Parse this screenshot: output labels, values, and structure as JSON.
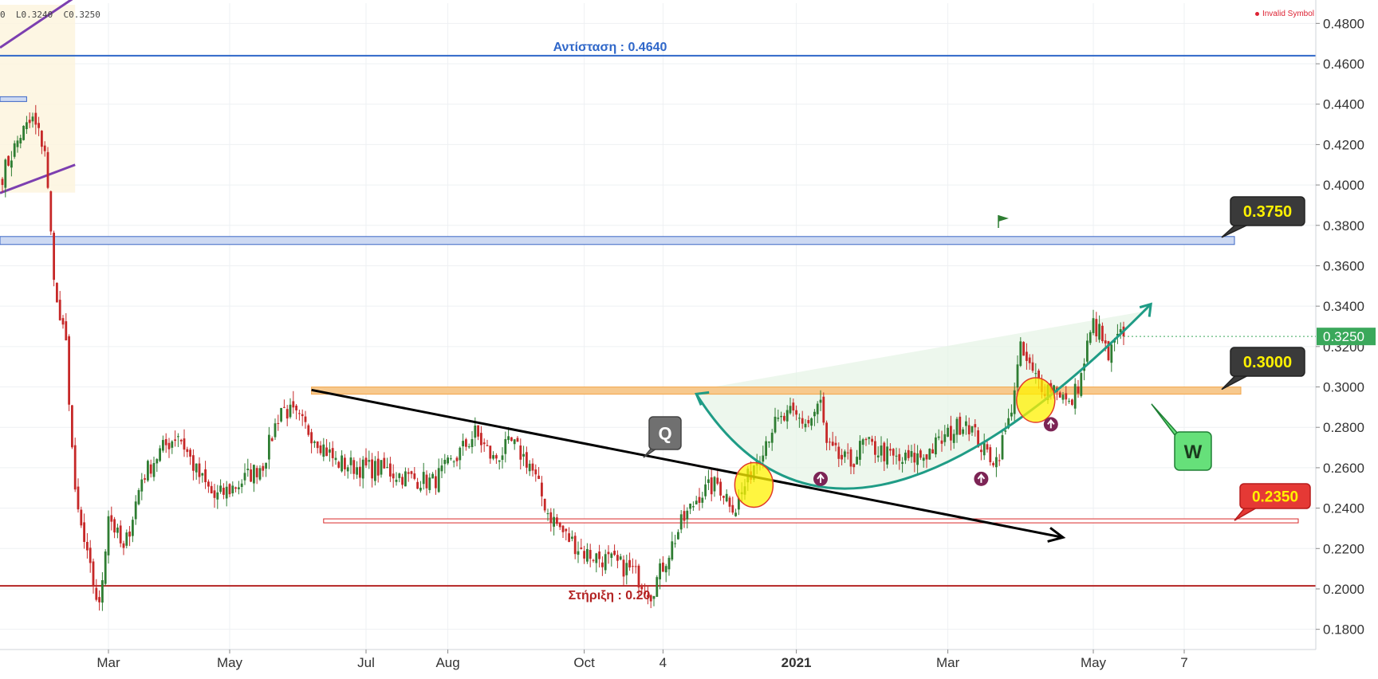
{
  "header": {
    "ohlc_text": "0  L0.3240  C0.3250",
    "invalid_symbol": "Invalid Symbol"
  },
  "colors": {
    "up_candle": "#2e7d32",
    "down_candle": "#c62828",
    "resistance_line": "#2f67c9",
    "support_line": "#b32323",
    "cup_arc": "#1f9c86",
    "trend_arrow": "#000000",
    "level_0375": "#3b66c6",
    "level_0300": "#f3a64a",
    "level_0235": "#d92a2a",
    "price_badge": "#3aa85b"
  },
  "annotations": {
    "resistance_label": "Αντίσταση : 0.4640",
    "support_label": "Στήριξη : 0.20",
    "callout_q": "Q",
    "callout_w": "W",
    "callout_0375": "0.3750",
    "callout_0300": "0.3000",
    "callout_0235": "0.2350",
    "last_price": "0.3250"
  },
  "chart_data": {
    "type": "candlestick",
    "title": "",
    "xlabel": "",
    "ylabel": "",
    "ylim": [
      0.17,
      0.49
    ],
    "y_ticks": [
      "0.4800",
      "0.4600",
      "0.4400",
      "0.4200",
      "0.4000",
      "0.3800",
      "0.3600",
      "0.3400",
      "0.3200",
      "0.3000",
      "0.2800",
      "0.2600",
      "0.2400",
      "0.2200",
      "0.2000",
      "0.1800"
    ],
    "x_ticks": [
      "Mar",
      "May",
      "Jul",
      "Aug",
      "Oct",
      "4",
      "2021",
      "Mar",
      "May",
      "7"
    ],
    "x_tick_bars": [
      35,
      75,
      120,
      147,
      192,
      218,
      262,
      312,
      360,
      390
    ],
    "grid": true,
    "horizontal_levels": [
      {
        "name": "resistance",
        "value": 0.464
      },
      {
        "name": "zone_0375",
        "value": 0.3725
      },
      {
        "name": "zone_0300",
        "value": 0.298
      },
      {
        "name": "zone_0235",
        "value": 0.2335
      },
      {
        "name": "support",
        "value": 0.2015
      }
    ],
    "bars_total": 415,
    "anchors": [
      [
        0,
        0.405
      ],
      [
        6,
        0.425
      ],
      [
        10,
        0.432
      ],
      [
        14,
        0.418
      ],
      [
        16,
        0.375
      ],
      [
        18,
        0.34
      ],
      [
        21,
        0.32
      ],
      [
        24,
        0.245
      ],
      [
        28,
        0.215
      ],
      [
        32,
        0.19
      ],
      [
        35,
        0.238
      ],
      [
        40,
        0.218
      ],
      [
        46,
        0.255
      ],
      [
        52,
        0.268
      ],
      [
        58,
        0.277
      ],
      [
        64,
        0.258
      ],
      [
        70,
        0.245
      ],
      [
        78,
        0.252
      ],
      [
        86,
        0.262
      ],
      [
        92,
        0.29
      ],
      [
        96,
        0.286
      ],
      [
        104,
        0.274
      ],
      [
        110,
        0.263
      ],
      [
        118,
        0.26
      ],
      [
        126,
        0.259
      ],
      [
        134,
        0.255
      ],
      [
        142,
        0.253
      ],
      [
        148,
        0.262
      ],
      [
        156,
        0.277
      ],
      [
        162,
        0.264
      ],
      [
        168,
        0.272
      ],
      [
        174,
        0.262
      ],
      [
        180,
        0.238
      ],
      [
        186,
        0.226
      ],
      [
        192,
        0.218
      ],
      [
        200,
        0.214
      ],
      [
        208,
        0.209
      ],
      [
        214,
        0.198
      ],
      [
        219,
        0.215
      ],
      [
        224,
        0.232
      ],
      [
        230,
        0.247
      ],
      [
        236,
        0.252
      ],
      [
        242,
        0.24
      ],
      [
        248,
        0.262
      ],
      [
        254,
        0.28
      ],
      [
        260,
        0.286
      ],
      [
        266,
        0.282
      ],
      [
        270,
        0.292
      ],
      [
        272,
        0.27
      ],
      [
        276,
        0.265
      ],
      [
        280,
        0.262
      ],
      [
        284,
        0.272
      ],
      [
        290,
        0.268
      ],
      [
        296,
        0.263
      ],
      [
        304,
        0.266
      ],
      [
        312,
        0.276
      ],
      [
        318,
        0.284
      ],
      [
        324,
        0.268
      ],
      [
        328,
        0.264
      ],
      [
        332,
        0.282
      ],
      [
        334,
        0.3
      ],
      [
        336,
        0.318
      ],
      [
        340,
        0.306
      ],
      [
        344,
        0.3
      ],
      [
        348,
        0.3
      ],
      [
        352,
        0.29
      ],
      [
        356,
        0.305
      ],
      [
        358,
        0.32
      ],
      [
        360,
        0.331
      ],
      [
        362,
        0.327
      ],
      [
        365,
        0.314
      ],
      [
        368,
        0.324
      ],
      [
        370,
        0.325
      ]
    ],
    "trend_arrow_data": {
      "from": [
        102,
        0.2985
      ],
      "to": [
        350,
        0.2255
      ]
    },
    "cup_arc_data": {
      "start": [
        229,
        0.2965
      ],
      "bottom": [
        290,
        0.2515
      ],
      "end": [
        379,
        0.341
      ]
    },
    "highlight_circles": [
      {
        "bar": 248,
        "value": 0.2515
      },
      {
        "bar": 341,
        "value": 0.2935
      }
    ],
    "up_markers": [
      {
        "bar": 270,
        "value": 0.2545
      },
      {
        "bar": 323,
        "value": 0.2545
      },
      {
        "bar": 346,
        "value": 0.2815
      }
    ]
  }
}
